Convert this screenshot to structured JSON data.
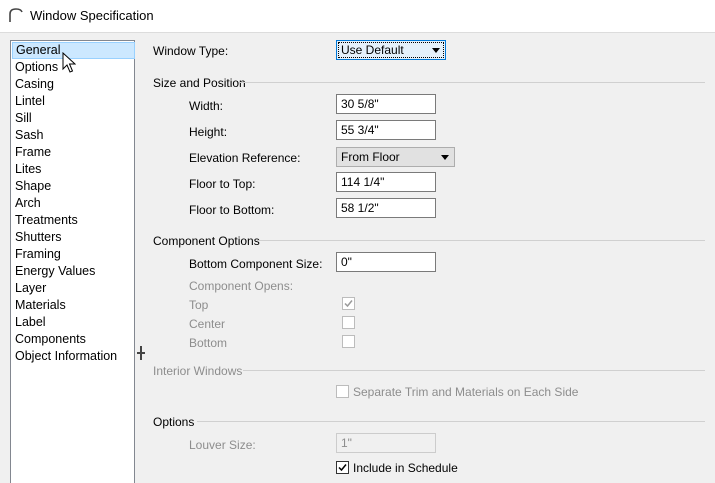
{
  "window": {
    "title": "Window Specification"
  },
  "sidebar": {
    "items": [
      {
        "label": "General",
        "selected": true
      },
      {
        "label": "Options"
      },
      {
        "label": "Casing"
      },
      {
        "label": "Lintel"
      },
      {
        "label": "Sill"
      },
      {
        "label": "Sash"
      },
      {
        "label": "Frame"
      },
      {
        "label": "Lites"
      },
      {
        "label": "Shape"
      },
      {
        "label": "Arch"
      },
      {
        "label": "Treatments"
      },
      {
        "label": "Shutters"
      },
      {
        "label": "Framing"
      },
      {
        "label": "Energy Values"
      },
      {
        "label": "Layer"
      },
      {
        "label": "Materials"
      },
      {
        "label": "Label"
      },
      {
        "label": "Components"
      },
      {
        "label": "Object Information"
      }
    ]
  },
  "general": {
    "window_type": {
      "label": "Window Type:",
      "value": "Use Default"
    },
    "size_position": {
      "heading": "Size and Position",
      "width": {
        "label": "Width:",
        "value": "30 5/8\""
      },
      "height": {
        "label": "Height:",
        "value": "55 3/4\""
      },
      "elevation_reference": {
        "label": "Elevation Reference:",
        "value": "From Floor"
      },
      "floor_to_top": {
        "label": "Floor to Top:",
        "value": "114 1/4\""
      },
      "floor_to_bottom": {
        "label": "Floor to Bottom:",
        "value": "58 1/2\""
      }
    },
    "component_options": {
      "heading": "Component Options",
      "bottom_component_size": {
        "label": "Bottom Component Size:",
        "value": "0\""
      },
      "component_opens_label": "Component Opens:",
      "top": {
        "label": "Top",
        "checked": true
      },
      "center": {
        "label": "Center",
        "checked": false
      },
      "bottom": {
        "label": "Bottom",
        "checked": false
      }
    },
    "interior_windows": {
      "heading": "Interior Windows",
      "separate_trim": {
        "label": "Separate Trim and Materials on Each Side",
        "checked": false
      }
    },
    "options": {
      "heading": "Options",
      "louver_size": {
        "label": "Louver Size:",
        "value": "1\""
      },
      "include_in_schedule": {
        "label": "Include in Schedule",
        "checked": true
      }
    }
  }
}
